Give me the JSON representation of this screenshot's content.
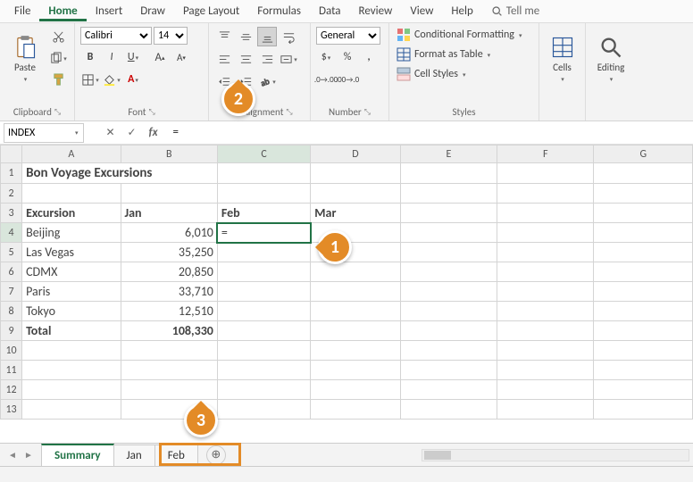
{
  "menu": {
    "items": [
      "File",
      "Home",
      "Insert",
      "Draw",
      "Page Layout",
      "Formulas",
      "Data",
      "Review",
      "View",
      "Help"
    ],
    "active": "Home",
    "tell_me": "Tell me"
  },
  "ribbon": {
    "clipboard": {
      "paste": "Paste",
      "label": "Clipboard"
    },
    "font": {
      "name": "Calibri",
      "size": "14",
      "label": "Font"
    },
    "alignment": {
      "label": "Alignment"
    },
    "number": {
      "format": "General",
      "label": "Number"
    },
    "styles": {
      "cond": "Conditional Formatting",
      "table": "Format as Table",
      "cell": "Cell Styles",
      "label": "Styles"
    },
    "cells": {
      "label": "Cells"
    },
    "editing": {
      "label": "Editing"
    }
  },
  "fbar": {
    "namebox": "INDEX",
    "formula": "="
  },
  "grid": {
    "columns": [
      "A",
      "B",
      "C",
      "D",
      "E",
      "F",
      "G"
    ],
    "title": "Bon Voyage Excursions",
    "headers": {
      "excursion": "Excursion",
      "jan": "Jan",
      "feb": "Feb",
      "mar": "Mar"
    },
    "rows": [
      {
        "name": "Beijing",
        "jan": "6,010"
      },
      {
        "name": "Las Vegas",
        "jan": "35,250"
      },
      {
        "name": "CDMX",
        "jan": "20,850"
      },
      {
        "name": "Paris",
        "jan": "33,710"
      },
      {
        "name": "Tokyo",
        "jan": "12,510"
      }
    ],
    "total": {
      "label": "Total",
      "jan": "108,330"
    },
    "active_cell_value": "="
  },
  "sheets": {
    "tabs": [
      "Summary",
      "Jan",
      "Feb"
    ],
    "active": "Summary"
  },
  "callouts": {
    "c1": "1",
    "c2": "2",
    "c3": "3"
  },
  "chart_data": {
    "type": "table",
    "title": "Bon Voyage Excursions",
    "columns": [
      "Excursion",
      "Jan",
      "Feb",
      "Mar"
    ],
    "rows": [
      [
        "Beijing",
        6010,
        null,
        null
      ],
      [
        "Las Vegas",
        35250,
        null,
        null
      ],
      [
        "CDMX",
        20850,
        null,
        null
      ],
      [
        "Paris",
        33710,
        null,
        null
      ],
      [
        "Tokyo",
        12510,
        null,
        null
      ],
      [
        "Total",
        108330,
        null,
        null
      ]
    ]
  }
}
